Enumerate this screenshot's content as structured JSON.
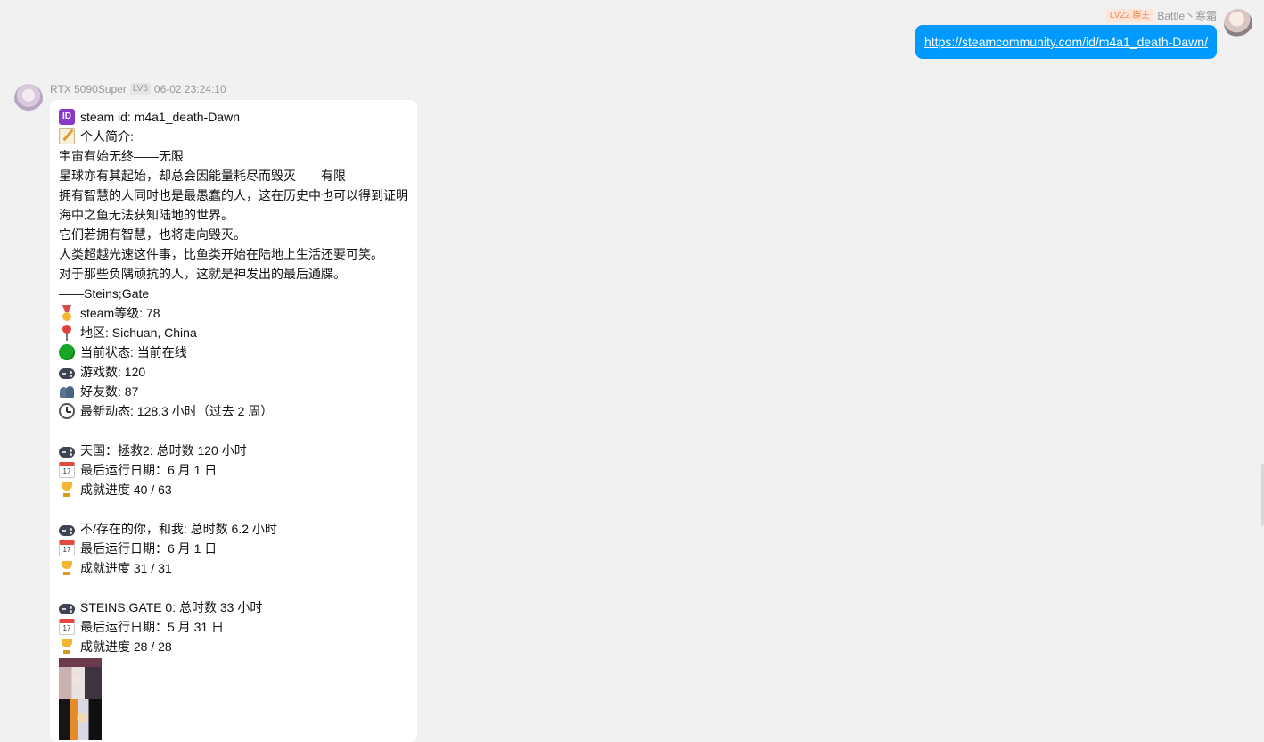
{
  "outgoing": {
    "badge": "LV22 群主",
    "sender": "Battle丶寒霜",
    "link": "https://steamcommunity.com/id/m4a1_death-Dawn/"
  },
  "incoming": {
    "sender": "RTX 5090Super",
    "level": "LV6",
    "time": "06-02 23:24:10",
    "lines": [
      {
        "icon": "id-icon",
        "text": "steam id: m4a1_death-Dawn"
      },
      {
        "icon": "memo-icon",
        "text": "个人简介:"
      },
      {
        "icon": "",
        "text": "宇宙有始无终——无限"
      },
      {
        "icon": "",
        "text": "星球亦有其起始，却总会因能量耗尽而毁灭——有限"
      },
      {
        "icon": "",
        "text": "拥有智慧的人同时也是最愚蠢的人，这在历史中也可以得到证明"
      },
      {
        "icon": "",
        "text": "海中之鱼无法获知陆地的世界。"
      },
      {
        "icon": "",
        "text": "它们若拥有智慧，也将走向毁灭。"
      },
      {
        "icon": "",
        "text": "人类超越光速这件事，比鱼类开始在陆地上生活还要可笑。"
      },
      {
        "icon": "",
        "text": "对于那些负隅顽抗的人，这就是神发出的最后通牒。"
      },
      {
        "icon": "",
        "text": "——Steins;Gate"
      },
      {
        "icon": "medal-icon",
        "text": "steam等级: 78"
      },
      {
        "icon": "pin-icon",
        "text": "地区: Sichuan, China"
      },
      {
        "icon": "green-circle-icon",
        "text": "当前状态: 当前在线"
      },
      {
        "icon": "gamepad-icon",
        "text": "游戏数: 120"
      },
      {
        "icon": "friends-icon",
        "text": "好友数: 87"
      },
      {
        "icon": "clock-icon",
        "text": "最新动态: 128.3 小时（过去 2 周）"
      },
      {
        "icon": "",
        "text": ""
      },
      {
        "icon": "gamepad-icon",
        "text": "天国：拯救2: 总时数 120 小时"
      },
      {
        "icon": "calendar-icon",
        "text": "最后运行日期：6 月 1 日"
      },
      {
        "icon": "trophy-icon",
        "text": "成就进度  40 / 63"
      },
      {
        "icon": "",
        "text": ""
      },
      {
        "icon": "gamepad-icon",
        "text": "不/存在的你，和我: 总时数 6.2 小时"
      },
      {
        "icon": "calendar-icon",
        "text": "最后运行日期：6 月 1 日"
      },
      {
        "icon": "trophy-icon",
        "text": "成就进度  31 / 31"
      },
      {
        "icon": "",
        "text": ""
      },
      {
        "icon": "gamepad-icon",
        "text": "STEINS;GATE 0: 总时数 33 小时"
      },
      {
        "icon": "calendar-icon",
        "text": "最后运行日期：5 月 31 日"
      },
      {
        "icon": "trophy-icon",
        "text": "成就进度  28 / 28"
      }
    ]
  },
  "calendar_glyph": "17",
  "id_glyph": "ID"
}
